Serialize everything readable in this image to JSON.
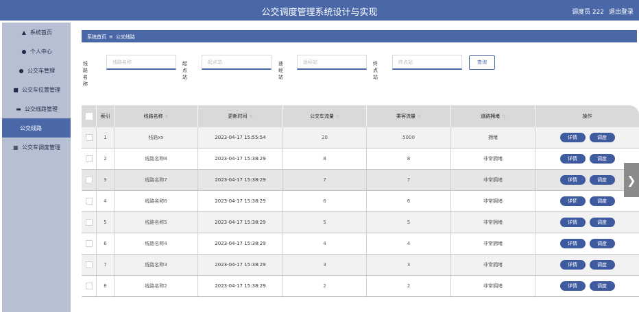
{
  "header": {
    "title": "公交调度管理系统设计与实现",
    "user": "调度员 222",
    "logout": "退出登录"
  },
  "sidebar": {
    "items": [
      {
        "label": "系统首页",
        "icon": "home-icon"
      },
      {
        "label": "个人中心",
        "icon": "user-icon"
      },
      {
        "label": "公交车管理",
        "icon": "user-icon"
      },
      {
        "label": "公交车位置管理",
        "icon": "clipboard-icon"
      },
      {
        "label": "公交线路管理",
        "icon": "bus-icon"
      },
      {
        "label": "公交线路",
        "icon": ""
      },
      {
        "label": "公交车调度管理",
        "icon": "grid-icon"
      }
    ]
  },
  "breadcrumb": {
    "home": "系统首页",
    "separator": "≡",
    "current": "公交线路"
  },
  "search": {
    "fields": [
      {
        "label": "线路名称",
        "placeholder": "线路名称"
      },
      {
        "label": "起点站",
        "placeholder": "起点站"
      },
      {
        "label": "途经站",
        "placeholder": "途经站"
      },
      {
        "label": "终点站",
        "placeholder": "终点站"
      }
    ],
    "button": "查询"
  },
  "table": {
    "columns": [
      "索引",
      "线路名称",
      "更新时间",
      "公交车流量",
      "乘客流量",
      "道路拥堵",
      "操作"
    ],
    "rows": [
      {
        "index": "1",
        "name": "线路xx",
        "time": "2023-04-17 15:55:54",
        "bus_flow": "20",
        "passenger_flow": "5000",
        "congestion": "拥堵"
      },
      {
        "index": "2",
        "name": "线路名称8",
        "time": "2023-04-17 15:38:29",
        "bus_flow": "8",
        "passenger_flow": "8",
        "congestion": "非常拥堵"
      },
      {
        "index": "3",
        "name": "线路名称7",
        "time": "2023-04-17 15:38:29",
        "bus_flow": "7",
        "passenger_flow": "7",
        "congestion": "非常拥堵"
      },
      {
        "index": "4",
        "name": "线路名称6",
        "time": "2023-04-17 15:38:29",
        "bus_flow": "6",
        "passenger_flow": "6",
        "congestion": "非常拥堵"
      },
      {
        "index": "5",
        "name": "线路名称5",
        "time": "2023-04-17 15:38:29",
        "bus_flow": "5",
        "passenger_flow": "5",
        "congestion": "非常拥堵"
      },
      {
        "index": "6",
        "name": "线路名称4",
        "time": "2023-04-17 15:38:29",
        "bus_flow": "4",
        "passenger_flow": "4",
        "congestion": "非常拥堵"
      },
      {
        "index": "7",
        "name": "线路名称3",
        "time": "2023-04-17 15:38:29",
        "bus_flow": "3",
        "passenger_flow": "3",
        "congestion": "非常拥堵"
      },
      {
        "index": "8",
        "name": "线路名称2",
        "time": "2023-04-17 15:38:29",
        "bus_flow": "2",
        "passenger_flow": "2",
        "congestion": "非常拥堵"
      }
    ],
    "detail_label": "详情",
    "dispatch_label": "调度"
  },
  "colors": {
    "primary": "#4a68a8",
    "sidebar": "#b7c0d3",
    "header_row": "#d9d9d9"
  }
}
